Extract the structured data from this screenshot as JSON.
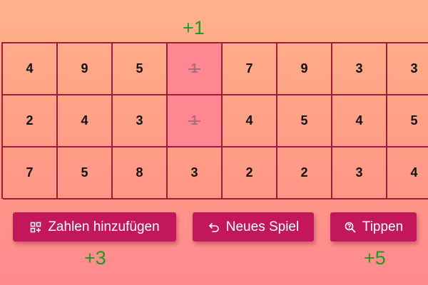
{
  "scores": {
    "top": "+1",
    "left": "+3",
    "right": "+5"
  },
  "board": {
    "rows": [
      [
        {
          "value": "4",
          "crossed": false
        },
        {
          "value": "9",
          "crossed": false
        },
        {
          "value": "5",
          "crossed": false
        },
        {
          "value": "1",
          "crossed": true
        },
        {
          "value": "7",
          "crossed": false
        },
        {
          "value": "9",
          "crossed": false
        },
        {
          "value": "3",
          "crossed": false
        },
        {
          "value": "3",
          "crossed": false
        }
      ],
      [
        {
          "value": "2",
          "crossed": false
        },
        {
          "value": "4",
          "crossed": false
        },
        {
          "value": "3",
          "crossed": false
        },
        {
          "value": "1",
          "crossed": true
        },
        {
          "value": "4",
          "crossed": false
        },
        {
          "value": "5",
          "crossed": false
        },
        {
          "value": "4",
          "crossed": false
        },
        {
          "value": "5",
          "crossed": false
        }
      ],
      [
        {
          "value": "7",
          "crossed": false
        },
        {
          "value": "5",
          "crossed": false
        },
        {
          "value": "8",
          "crossed": false
        },
        {
          "value": "3",
          "crossed": false
        },
        {
          "value": "2",
          "crossed": false
        },
        {
          "value": "2",
          "crossed": false
        },
        {
          "value": "3",
          "crossed": false
        },
        {
          "value": "4",
          "crossed": false
        }
      ]
    ]
  },
  "buttons": {
    "add_numbers": {
      "label": "Zahlen hinzufügen",
      "icon": "add-grid-icon"
    },
    "new_game": {
      "label": "Neues Spiel",
      "icon": "undo-arrow-icon"
    },
    "hint": {
      "label": "Tippen",
      "icon": "magnifier-question-icon"
    }
  },
  "colors": {
    "grid_line": "#9b1d3c",
    "crossed_cell_bg": "#ff8791",
    "button_bg": "#c2185b",
    "score_text": "#1f9a22"
  }
}
